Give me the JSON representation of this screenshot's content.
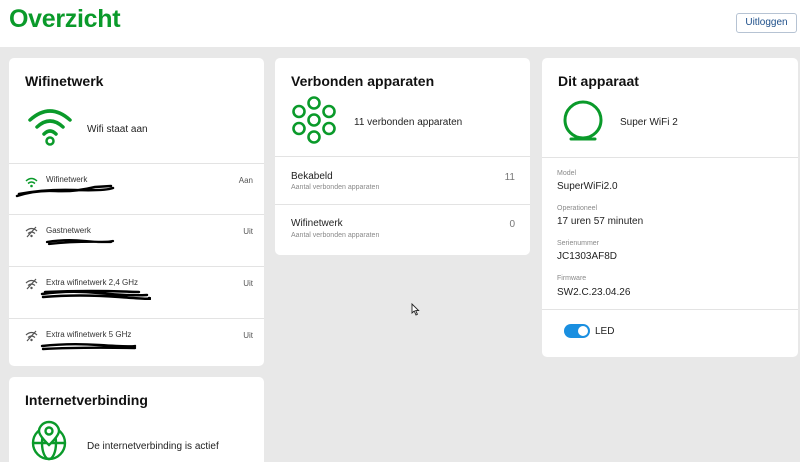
{
  "header": {
    "title": "Overzicht",
    "logout_label": "Uitloggen"
  },
  "wifi": {
    "title": "Wifinetwerk",
    "status": "Wifi staat aan",
    "networks": [
      {
        "name": "Wifinetwerk",
        "state": "Aan"
      },
      {
        "name": "Gastnetwerk",
        "state": "Uit"
      },
      {
        "name": "Extra wifinetwerk 2,4 GHz",
        "state": "Uit"
      },
      {
        "name": "Extra wifinetwerk 5 GHz",
        "state": "Uit"
      }
    ]
  },
  "devices": {
    "title": "Verbonden apparaten",
    "summary": "11 verbonden apparaten",
    "rows": [
      {
        "label": "Bekabeld",
        "sub": "Aantal verbonden apparaten",
        "count": "11"
      },
      {
        "label": "Wifinetwerk",
        "sub": "Aantal verbonden apparaten",
        "count": "0"
      }
    ]
  },
  "this_device": {
    "title": "Dit apparaat",
    "name": "Super WiFi 2",
    "model_label": "Model",
    "model_value": "SuperWiFi2.0",
    "uptime_label": "Operationeel",
    "uptime_value": "17 uren 57 minuten",
    "serial_label": "Serienummer",
    "serial_value": "JC1303AF8D",
    "firmware_label": "Firmware",
    "firmware_value": "SW2.C.23.04.26",
    "led_label": "LED",
    "led_on": true
  },
  "internet": {
    "title": "Internetverbinding",
    "status": "De internetverbinding is actief"
  },
  "colors": {
    "brand_green": "#0a9a2a",
    "toggle_blue": "#1a8fe0"
  },
  "icons": [
    "wifi-icon",
    "network-nodes-icon",
    "device-icon",
    "globe-icon",
    "wifi-off-icon",
    "mouse-cursor-icon"
  ]
}
